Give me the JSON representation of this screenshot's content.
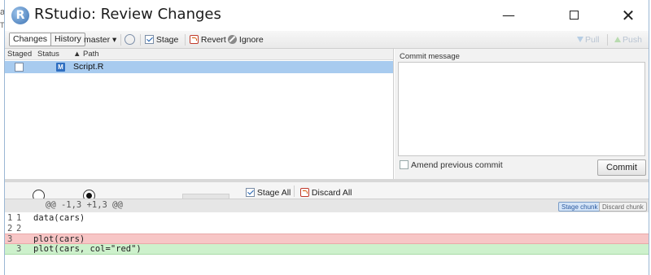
{
  "window": {
    "title": "RStudio: Review Changes",
    "app_icon_letter": "R",
    "minimize_glyph": "—",
    "close_glyph": "✕"
  },
  "toolbar": {
    "tabs": [
      {
        "label": "Changes",
        "active": true
      },
      {
        "label": "History",
        "active": false
      }
    ],
    "branch": "master ▾",
    "refresh_icon": "refresh-icon",
    "stage_label": "Stage",
    "revert_label": "Revert",
    "ignore_label": "Ignore",
    "pull_label": "Pull",
    "push_label": "Push"
  },
  "filelist": {
    "headers": {
      "staged": "Staged",
      "status": "Status",
      "path": "▲ Path"
    },
    "files": [
      {
        "staged": false,
        "status": "M",
        "path": "Script.R",
        "selected": true
      }
    ]
  },
  "commit": {
    "message_label": "Commit message",
    "message_value": "",
    "amend_label": "Amend previous commit",
    "commit_button": "Commit"
  },
  "diff_toolbar": {
    "stage_all_label": "Stage All",
    "discard_all_label": "Discard All"
  },
  "diff": {
    "hunk_header": "@@ -1,3 +1,3 @@",
    "stage_chunk_label": "Stage chunk",
    "discard_chunk_label": "Discard chunk",
    "lines": [
      {
        "type": "ctx",
        "old": "1",
        "new": "1",
        "code": "data(cars)"
      },
      {
        "type": "ctx",
        "old": "2",
        "new": "2",
        "code": ""
      },
      {
        "type": "del",
        "old": "3",
        "new": "",
        "code": "plot(cars)"
      },
      {
        "type": "add",
        "old": "",
        "new": "3",
        "code": "plot(cars, col=\"red\")"
      }
    ]
  },
  "colors": {
    "selection": "#a8cbef",
    "deleted_line": "#f7c6c6",
    "added_line": "#cdf1cc",
    "accent": "#2f6fc1"
  },
  "background": {
    "edge_text_1": "a",
    "edge_text_2": "T"
  }
}
